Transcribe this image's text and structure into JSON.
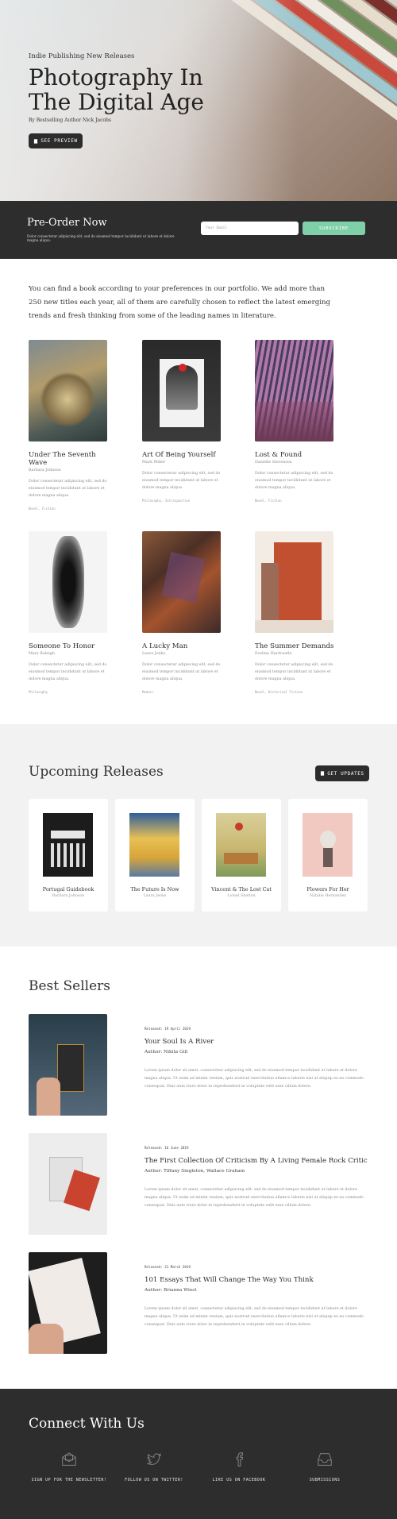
{
  "hero": {
    "kicker": "Indie Publishing New Releases",
    "title_line1": "Photography In",
    "title_line2": "The Digital Age",
    "byline": "By Bestselling Author Nick Jacobs",
    "button_label": "SEE PREVIEW"
  },
  "preorder": {
    "title": "Pre-Order Now",
    "subtitle": "Dolor consectetur adipiscing elit, sed do eiusmod tempor incididunt ut labore et dolore magna aliqua.",
    "email_placeholder": "Your Email",
    "subscribe_label": "SUBSCRIBE"
  },
  "intro": {
    "text": "You can find a book according to your preferences in our portfolio. We add more than 250 new titles each year, all of them are carefully chosen to reflect the latest emerging trends and fresh thinking from some of the leading names in literature."
  },
  "books": [
    {
      "title": "Under The Seventh Wave",
      "author": "Barbara Johnson",
      "description": "Dolor consectetur adipiscing elit, sed do eiusmod tempor incididunt ut labore et dolore magna aliqua.",
      "tags": "Novel, Fiction"
    },
    {
      "title": "Art Of Being Yourself",
      "author": "Mark Miller",
      "description": "Dolor consectetur adipiscing elit, sed do eiusmod tempor incididunt ut labore et dolore magna aliqua.",
      "tags": "Philosophy, Introspection"
    },
    {
      "title": "Lost & Found",
      "author": "Danielle Stevenson",
      "description": "Dolor consectetur adipiscing elit, sed do eiusmod tempor incididunt ut labore et dolore magna aliqua.",
      "tags": "Novel, Fiction"
    },
    {
      "title": "Someone To Honor",
      "author": "Mary Raleigh",
      "description": "Dolor consectetur adipiscing elit, sed do eiusmod tempor incididunt ut labore et dolore magna aliqua.",
      "tags": "Philosophy"
    },
    {
      "title": "A Lucky Man",
      "author": "Laura Jenks",
      "description": "Dolor consectetur adipiscing elit, sed do eiusmod tempor incididunt ut labore et dolore magna aliqua.",
      "tags": "Memoir"
    },
    {
      "title": "The Summer Demands",
      "author": "Eveline Hardcastle",
      "description": "Dolor consectetur adipiscing elit, sed do eiusmod tempor incididunt ut labore et dolore magna aliqua.",
      "tags": "Novel, Historical Fiction"
    }
  ],
  "upcoming": {
    "title": "Upcoming Releases",
    "button_label": "GET UPDATES",
    "items": [
      {
        "title": "Portugal Guidebook",
        "author": "Barbara Johnson"
      },
      {
        "title": "The Future Is Now",
        "author": "Laura Jenks"
      },
      {
        "title": "Vincent & The Lost Cat",
        "author": "Lionel Shelton"
      },
      {
        "title": "Flowers For Her",
        "author": "Natalie Hernandez"
      }
    ]
  },
  "best_sellers": {
    "title": "Best Sellers",
    "items": [
      {
        "date": "Released: 19 April 2019",
        "title": "Your Soul Is A River",
        "author": "Author: Nikita Gill",
        "description": "Lorem ipsum dolor sit amet, consectetur adipiscing elit, sed do eiusmod tempor incididunt ut labore et dolore magna aliqua. Ut enim ad minim veniam, quis nostrud exercitation ullamco laboris nisi ut aliquip ex ea commodo consequat. Duis aute irure dolor in reprehenderit in voluptate velit esse cillum dolore."
      },
      {
        "date": "Released: 16 June 2019",
        "title": "The First Collection Of Criticism By A Living Female Rock Critic",
        "author": "Author: Tiffany Singleton, Wallace Graham",
        "description": "Lorem ipsum dolor sit amet, consectetur adipiscing elit, sed do eiusmod tempor incididunt ut labore et dolore magna aliqua. Ut enim ad minim veniam, quis nostrud exercitation ullamco laboris nisi ut aliquip ex ea commodo consequat. Duis aute irure dolor in reprehenderit in voluptate velit esse cillum dolore."
      },
      {
        "date": "Released: 21 March 2019",
        "title": "101 Essays That Will Change The Way You Think",
        "author": "Author: Brianna Wiest",
        "description": "Lorem ipsum dolor sit amet, consectetur adipiscing elit, sed do eiusmod tempor incididunt ut labore et dolore magna aliqua. Ut enim ad minim veniam, quis nostrud exercitation ullamco laboris nisi ut aliquip ex ea commodo consequat. Duis aute irure dolor in reprehenderit in voluptate velit esse cillum dolore."
      }
    ]
  },
  "connect": {
    "title": "Connect With Us",
    "items": [
      {
        "label": "SIGN UP FOR THE NEWSLETTER!",
        "icon": "envelope-icon"
      },
      {
        "label": "FOLLOW US ON TWITTER!",
        "icon": "twitter-icon"
      },
      {
        "label": "LIKE US ON FACEBOOK",
        "icon": "facebook-icon"
      },
      {
        "label": "SUBMISSIONS",
        "icon": "inbox-icon"
      }
    ]
  }
}
